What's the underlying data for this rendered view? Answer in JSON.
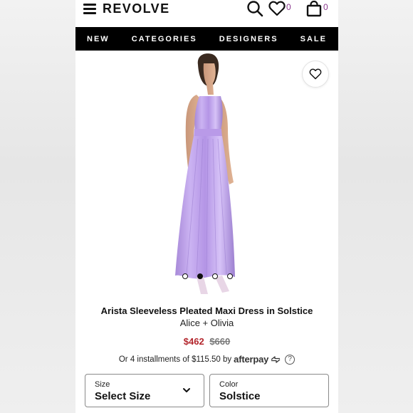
{
  "header": {
    "logo": "REVOLVE",
    "wishlist_count": "0",
    "bag_count": "0"
  },
  "nav": {
    "items": [
      {
        "label": "NEW"
      },
      {
        "label": "CATEGORIES"
      },
      {
        "label": "DESIGNERS"
      },
      {
        "label": "SALE"
      }
    ]
  },
  "carousel": {
    "dots": 4,
    "active_index": 1
  },
  "product": {
    "title": "Arista Sleeveless Pleated Maxi Dress in Solstice",
    "brand": "Alice + Olivia",
    "price_sale": "$462",
    "price_original": "$660",
    "installments_text": "Or 4 installments of $115.50 by",
    "afterpay_label": "afterpay",
    "info_symbol": "?"
  },
  "selects": {
    "size": {
      "label": "Size",
      "value": "Select Size"
    },
    "color": {
      "label": "Color",
      "value": "Solstice"
    }
  },
  "colors": {
    "accent_count": "#8b3a8f",
    "sale_price": "#b3262d",
    "nav_bg": "#000000",
    "dress": "#b89be8"
  }
}
